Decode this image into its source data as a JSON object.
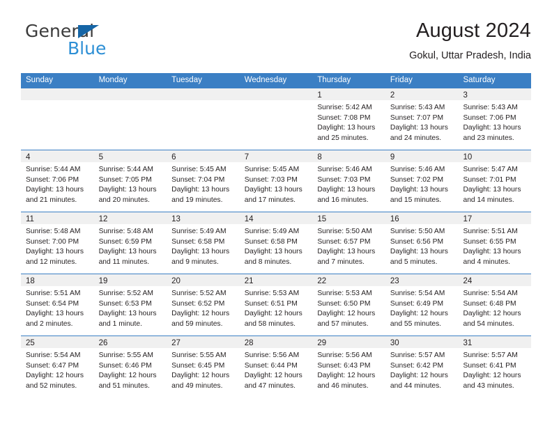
{
  "brand": {
    "name_top": "General",
    "name_bottom": "Blue",
    "triangle_color": "#1565a6",
    "blue_color": "#2d8fd5"
  },
  "header": {
    "title": "August 2024",
    "subtitle": "Gokul, Uttar Pradesh, India"
  },
  "theme": {
    "header_blue": "#3b7fc4",
    "strip_gray": "#f0f0f0",
    "text": "#231f20"
  },
  "weekdays": [
    "Sunday",
    "Monday",
    "Tuesday",
    "Wednesday",
    "Thursday",
    "Friday",
    "Saturday"
  ],
  "weeks": [
    [
      {
        "day": "",
        "empty": true
      },
      {
        "day": "",
        "empty": true
      },
      {
        "day": "",
        "empty": true
      },
      {
        "day": "",
        "empty": true
      },
      {
        "day": "1",
        "sunrise": "Sunrise: 5:42 AM",
        "sunset": "Sunset: 7:08 PM",
        "daylight1": "Daylight: 13 hours",
        "daylight2": "and 25 minutes."
      },
      {
        "day": "2",
        "sunrise": "Sunrise: 5:43 AM",
        "sunset": "Sunset: 7:07 PM",
        "daylight1": "Daylight: 13 hours",
        "daylight2": "and 24 minutes."
      },
      {
        "day": "3",
        "sunrise": "Sunrise: 5:43 AM",
        "sunset": "Sunset: 7:06 PM",
        "daylight1": "Daylight: 13 hours",
        "daylight2": "and 23 minutes."
      }
    ],
    [
      {
        "day": "4",
        "sunrise": "Sunrise: 5:44 AM",
        "sunset": "Sunset: 7:06 PM",
        "daylight1": "Daylight: 13 hours",
        "daylight2": "and 21 minutes."
      },
      {
        "day": "5",
        "sunrise": "Sunrise: 5:44 AM",
        "sunset": "Sunset: 7:05 PM",
        "daylight1": "Daylight: 13 hours",
        "daylight2": "and 20 minutes."
      },
      {
        "day": "6",
        "sunrise": "Sunrise: 5:45 AM",
        "sunset": "Sunset: 7:04 PM",
        "daylight1": "Daylight: 13 hours",
        "daylight2": "and 19 minutes."
      },
      {
        "day": "7",
        "sunrise": "Sunrise: 5:45 AM",
        "sunset": "Sunset: 7:03 PM",
        "daylight1": "Daylight: 13 hours",
        "daylight2": "and 17 minutes."
      },
      {
        "day": "8",
        "sunrise": "Sunrise: 5:46 AM",
        "sunset": "Sunset: 7:03 PM",
        "daylight1": "Daylight: 13 hours",
        "daylight2": "and 16 minutes."
      },
      {
        "day": "9",
        "sunrise": "Sunrise: 5:46 AM",
        "sunset": "Sunset: 7:02 PM",
        "daylight1": "Daylight: 13 hours",
        "daylight2": "and 15 minutes."
      },
      {
        "day": "10",
        "sunrise": "Sunrise: 5:47 AM",
        "sunset": "Sunset: 7:01 PM",
        "daylight1": "Daylight: 13 hours",
        "daylight2": "and 14 minutes."
      }
    ],
    [
      {
        "day": "11",
        "sunrise": "Sunrise: 5:48 AM",
        "sunset": "Sunset: 7:00 PM",
        "daylight1": "Daylight: 13 hours",
        "daylight2": "and 12 minutes."
      },
      {
        "day": "12",
        "sunrise": "Sunrise: 5:48 AM",
        "sunset": "Sunset: 6:59 PM",
        "daylight1": "Daylight: 13 hours",
        "daylight2": "and 11 minutes."
      },
      {
        "day": "13",
        "sunrise": "Sunrise: 5:49 AM",
        "sunset": "Sunset: 6:58 PM",
        "daylight1": "Daylight: 13 hours",
        "daylight2": "and 9 minutes."
      },
      {
        "day": "14",
        "sunrise": "Sunrise: 5:49 AM",
        "sunset": "Sunset: 6:58 PM",
        "daylight1": "Daylight: 13 hours",
        "daylight2": "and 8 minutes."
      },
      {
        "day": "15",
        "sunrise": "Sunrise: 5:50 AM",
        "sunset": "Sunset: 6:57 PM",
        "daylight1": "Daylight: 13 hours",
        "daylight2": "and 7 minutes."
      },
      {
        "day": "16",
        "sunrise": "Sunrise: 5:50 AM",
        "sunset": "Sunset: 6:56 PM",
        "daylight1": "Daylight: 13 hours",
        "daylight2": "and 5 minutes."
      },
      {
        "day": "17",
        "sunrise": "Sunrise: 5:51 AM",
        "sunset": "Sunset: 6:55 PM",
        "daylight1": "Daylight: 13 hours",
        "daylight2": "and 4 minutes."
      }
    ],
    [
      {
        "day": "18",
        "sunrise": "Sunrise: 5:51 AM",
        "sunset": "Sunset: 6:54 PM",
        "daylight1": "Daylight: 13 hours",
        "daylight2": "and 2 minutes."
      },
      {
        "day": "19",
        "sunrise": "Sunrise: 5:52 AM",
        "sunset": "Sunset: 6:53 PM",
        "daylight1": "Daylight: 13 hours",
        "daylight2": "and 1 minute."
      },
      {
        "day": "20",
        "sunrise": "Sunrise: 5:52 AM",
        "sunset": "Sunset: 6:52 PM",
        "daylight1": "Daylight: 12 hours",
        "daylight2": "and 59 minutes."
      },
      {
        "day": "21",
        "sunrise": "Sunrise: 5:53 AM",
        "sunset": "Sunset: 6:51 PM",
        "daylight1": "Daylight: 12 hours",
        "daylight2": "and 58 minutes."
      },
      {
        "day": "22",
        "sunrise": "Sunrise: 5:53 AM",
        "sunset": "Sunset: 6:50 PM",
        "daylight1": "Daylight: 12 hours",
        "daylight2": "and 57 minutes."
      },
      {
        "day": "23",
        "sunrise": "Sunrise: 5:54 AM",
        "sunset": "Sunset: 6:49 PM",
        "daylight1": "Daylight: 12 hours",
        "daylight2": "and 55 minutes."
      },
      {
        "day": "24",
        "sunrise": "Sunrise: 5:54 AM",
        "sunset": "Sunset: 6:48 PM",
        "daylight1": "Daylight: 12 hours",
        "daylight2": "and 54 minutes."
      }
    ],
    [
      {
        "day": "25",
        "sunrise": "Sunrise: 5:54 AM",
        "sunset": "Sunset: 6:47 PM",
        "daylight1": "Daylight: 12 hours",
        "daylight2": "and 52 minutes."
      },
      {
        "day": "26",
        "sunrise": "Sunrise: 5:55 AM",
        "sunset": "Sunset: 6:46 PM",
        "daylight1": "Daylight: 12 hours",
        "daylight2": "and 51 minutes."
      },
      {
        "day": "27",
        "sunrise": "Sunrise: 5:55 AM",
        "sunset": "Sunset: 6:45 PM",
        "daylight1": "Daylight: 12 hours",
        "daylight2": "and 49 minutes."
      },
      {
        "day": "28",
        "sunrise": "Sunrise: 5:56 AM",
        "sunset": "Sunset: 6:44 PM",
        "daylight1": "Daylight: 12 hours",
        "daylight2": "and 47 minutes."
      },
      {
        "day": "29",
        "sunrise": "Sunrise: 5:56 AM",
        "sunset": "Sunset: 6:43 PM",
        "daylight1": "Daylight: 12 hours",
        "daylight2": "and 46 minutes."
      },
      {
        "day": "30",
        "sunrise": "Sunrise: 5:57 AM",
        "sunset": "Sunset: 6:42 PM",
        "daylight1": "Daylight: 12 hours",
        "daylight2": "and 44 minutes."
      },
      {
        "day": "31",
        "sunrise": "Sunrise: 5:57 AM",
        "sunset": "Sunset: 6:41 PM",
        "daylight1": "Daylight: 12 hours",
        "daylight2": "and 43 minutes."
      }
    ]
  ]
}
